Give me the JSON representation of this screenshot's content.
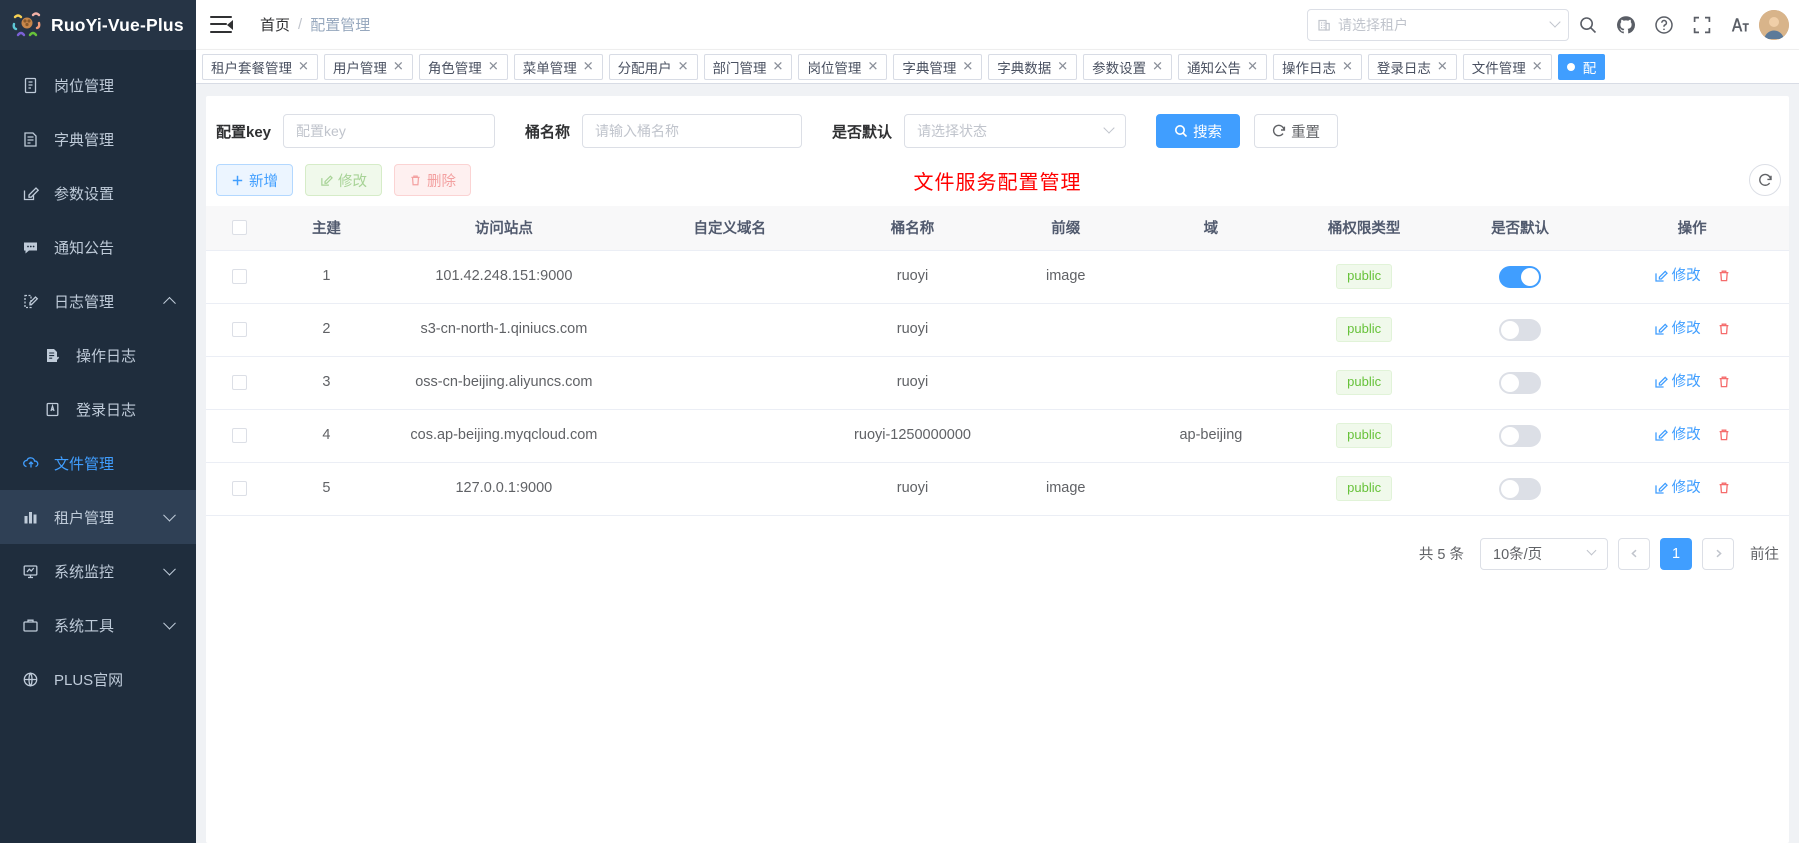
{
  "app": {
    "title": "RuoYi-Vue-Plus",
    "logo_icon": "team-hands-logo-icon"
  },
  "navbar": {
    "hamburger_icon": "hamburger-collapse-icon",
    "breadcrumb": {
      "home": "首页",
      "separator": "/",
      "current": "配置管理"
    },
    "tenant_select": {
      "value": "",
      "placeholder": "请选择租户",
      "icon": "building-icon"
    },
    "icons": [
      "search-icon",
      "github-icon",
      "help-icon",
      "fullscreen-icon",
      "font-size-icon",
      "avatar"
    ]
  },
  "tags": [
    {
      "label": "租户套餐管理",
      "active": false
    },
    {
      "label": "用户管理",
      "active": false
    },
    {
      "label": "角色管理",
      "active": false
    },
    {
      "label": "菜单管理",
      "active": false
    },
    {
      "label": "分配用户",
      "active": false
    },
    {
      "label": "部门管理",
      "active": false
    },
    {
      "label": "岗位管理",
      "active": false
    },
    {
      "label": "字典管理",
      "active": false
    },
    {
      "label": "字典数据",
      "active": false
    },
    {
      "label": "参数设置",
      "active": false
    },
    {
      "label": "通知公告",
      "active": false
    },
    {
      "label": "操作日志",
      "active": false
    },
    {
      "label": "登录日志",
      "active": false
    },
    {
      "label": "文件管理",
      "active": false
    },
    {
      "label": "配",
      "active": true
    }
  ],
  "sidebar": {
    "items": [
      {
        "label": "岗位管理",
        "icon": "post-icon",
        "level": 1,
        "active": false,
        "arrow": ""
      },
      {
        "label": "字典管理",
        "icon": "dict-icon",
        "level": 1,
        "active": false,
        "arrow": ""
      },
      {
        "label": "参数设置",
        "icon": "edit-square-icon",
        "level": 1,
        "active": false,
        "arrow": ""
      },
      {
        "label": "通知公告",
        "icon": "message-icon",
        "level": 1,
        "active": false,
        "arrow": ""
      },
      {
        "label": "日志管理",
        "icon": "log-icon",
        "level": 1,
        "active": false,
        "arrow": "up"
      },
      {
        "label": "操作日志",
        "icon": "operlog-icon",
        "level": 2,
        "active": false,
        "arrow": ""
      },
      {
        "label": "登录日志",
        "icon": "logininfor-icon",
        "level": 2,
        "active": false,
        "arrow": ""
      },
      {
        "label": "文件管理",
        "icon": "upload-cloud-icon",
        "level": 1,
        "active": true,
        "arrow": ""
      },
      {
        "label": "租户管理",
        "icon": "chart-bar-icon",
        "level": 1,
        "active": false,
        "arrow": "down"
      },
      {
        "label": "系统监控",
        "icon": "monitor-icon",
        "level": 1,
        "active": false,
        "arrow": "down"
      },
      {
        "label": "系统工具",
        "icon": "tool-icon",
        "level": 1,
        "active": false,
        "arrow": "down"
      },
      {
        "label": "PLUS官网",
        "icon": "globe-icon",
        "level": 1,
        "active": false,
        "arrow": ""
      }
    ]
  },
  "search_form": {
    "fields": [
      {
        "label": "配置key",
        "placeholder": "配置key",
        "value": "",
        "type": "input"
      },
      {
        "label": "桶名称",
        "placeholder": "请输入桶名称",
        "value": "",
        "type": "input"
      },
      {
        "label": "是否默认",
        "placeholder": "请选择状态",
        "value": "",
        "type": "select"
      }
    ],
    "search_button": "搜索",
    "search_icon": "search-icon",
    "reset_button": "重置",
    "reset_icon": "refresh-icon"
  },
  "toolbar": {
    "add_label": "新增",
    "add_icon": "plus-icon",
    "edit_label": "修改",
    "edit_icon": "edit-icon",
    "delete_label": "删除",
    "delete_icon": "trash-icon",
    "right_icons": [
      "refresh-circle-icon"
    ]
  },
  "page_title": "文件服务配置管理",
  "page_title_color": "#ff0000",
  "table": {
    "columns": [
      "",
      "主建",
      "访问站点",
      "自定义域名",
      "桶名称",
      "前缀",
      "域",
      "桶权限类型",
      "是否默认",
      "操作"
    ],
    "rows": [
      {
        "id": "1",
        "endpoint": "101.42.248.151:9000",
        "domain": "",
        "bucket": "ruoyi",
        "prefix": "image",
        "region": "",
        "access_policy": "public",
        "is_default": true,
        "edit_label": "修改",
        "delete_label": "删除"
      },
      {
        "id": "2",
        "endpoint": "s3-cn-north-1.qiniucs.com",
        "domain": "",
        "bucket": "ruoyi",
        "prefix": "",
        "region": "",
        "access_policy": "public",
        "is_default": false,
        "edit_label": "修改",
        "delete_label": "删除"
      },
      {
        "id": "3",
        "endpoint": "oss-cn-beijing.aliyuncs.com",
        "domain": "",
        "bucket": "ruoyi",
        "prefix": "",
        "region": "",
        "access_policy": "public",
        "is_default": false,
        "edit_label": "修改",
        "delete_label": "删除"
      },
      {
        "id": "4",
        "endpoint": "cos.ap-beijing.myqcloud.com",
        "domain": "",
        "bucket": "ruoyi-1250000000",
        "prefix": "",
        "region": "ap-beijing",
        "access_policy": "public",
        "is_default": false,
        "edit_label": "修改",
        "delete_label": "删除"
      },
      {
        "id": "5",
        "endpoint": "127.0.0.1:9000",
        "domain": "",
        "bucket": "ruoyi",
        "prefix": "image",
        "region": "",
        "access_policy": "public",
        "is_default": false,
        "edit_label": "修改",
        "delete_label": "删除"
      }
    ]
  },
  "pagination": {
    "total_text": "共 5 条",
    "page_size": "10条/页",
    "current_page": "1",
    "goto_text": "前往",
    "prev_icon": "chevron-left-icon",
    "next_icon": "chevron-right-icon"
  },
  "colors": {
    "brand_blue": "#409eff",
    "sidebar_bg": "#1f2d3d",
    "sidebar_logo_bg": "#263445",
    "title_red": "#ff0000",
    "tag_green": "#67c23a",
    "danger_red": "#f56c6c"
  }
}
